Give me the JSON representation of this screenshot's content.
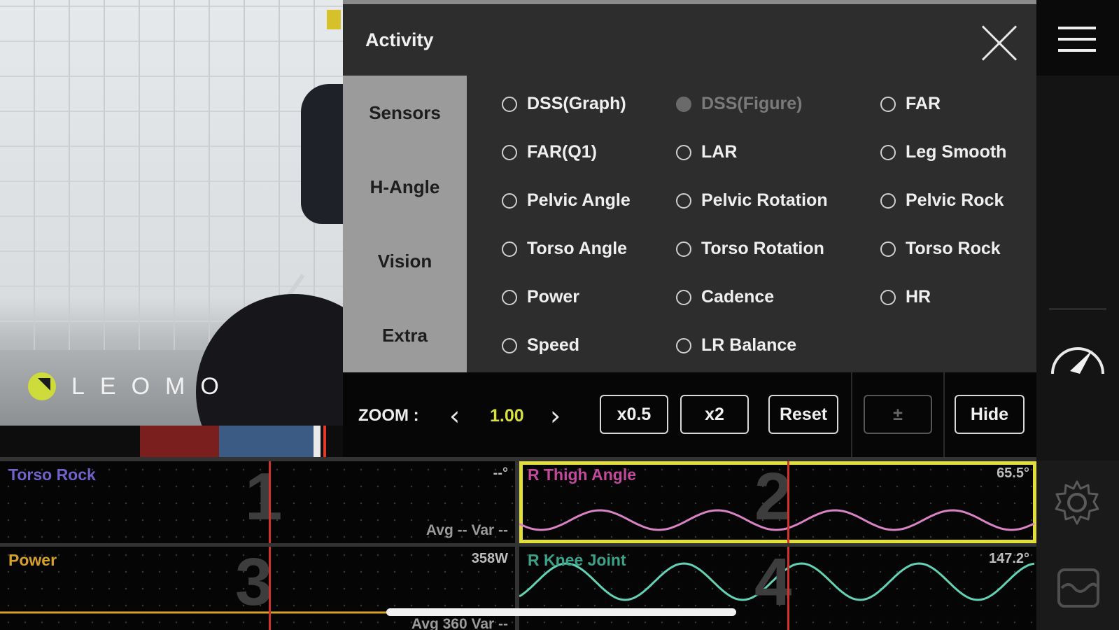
{
  "video": {
    "logo_text": "LEOMO"
  },
  "panel": {
    "title": "Activity",
    "close_label": "",
    "tabs": [
      "Sensors",
      "H-Angle",
      "Vision",
      "Extra"
    ],
    "options": [
      {
        "label": "DSS(Graph)",
        "enabled": true
      },
      {
        "label": "DSS(Figure)",
        "enabled": false
      },
      {
        "label": "FAR",
        "enabled": true
      },
      {
        "label": "FAR(Q1)",
        "enabled": true
      },
      {
        "label": "LAR",
        "enabled": true
      },
      {
        "label": "Leg Smooth",
        "enabled": true
      },
      {
        "label": "Pelvic Angle",
        "enabled": true
      },
      {
        "label": "Pelvic Rotation",
        "enabled": true
      },
      {
        "label": "Pelvic Rock",
        "enabled": true
      },
      {
        "label": "Torso Angle",
        "enabled": true
      },
      {
        "label": "Torso Rotation",
        "enabled": true
      },
      {
        "label": "Torso Rock",
        "enabled": true
      },
      {
        "label": "Power",
        "enabled": true
      },
      {
        "label": "Cadence",
        "enabled": true
      },
      {
        "label": "HR",
        "enabled": true
      },
      {
        "label": "Speed",
        "enabled": true
      },
      {
        "label": "LR Balance",
        "enabled": true
      }
    ]
  },
  "zoom": {
    "label": "ZOOM :",
    "prev": "‹",
    "value": "1.00",
    "next": "›",
    "half": "x0.5",
    "double": "x2",
    "reset": "Reset",
    "plusminus": "±",
    "hide": "Hide"
  },
  "graphs": [
    {
      "label": "Torso Rock",
      "value": "--°",
      "number": "1",
      "avg": "Avg -- Var --",
      "color": "#6f62c9"
    },
    {
      "label": "R Thigh Angle",
      "value": "65.5°",
      "number": "2",
      "avg": "",
      "color": "#c24a9c",
      "selected": true
    },
    {
      "label": "Power",
      "value": "358W",
      "number": "3",
      "avg": "Avg 360 Var --",
      "color": "#d6a12a"
    },
    {
      "label": "R Knee Joint",
      "value": "147.2°",
      "number": "4",
      "avg": "",
      "color": "#3aa38a"
    }
  ],
  "colors": {
    "accent_yellow": "#d9df3c",
    "thigh_wave": "#d983c6",
    "knee_wave": "#62d1b5",
    "power_line": "#d6a12a",
    "playhead": "#d1322a"
  }
}
